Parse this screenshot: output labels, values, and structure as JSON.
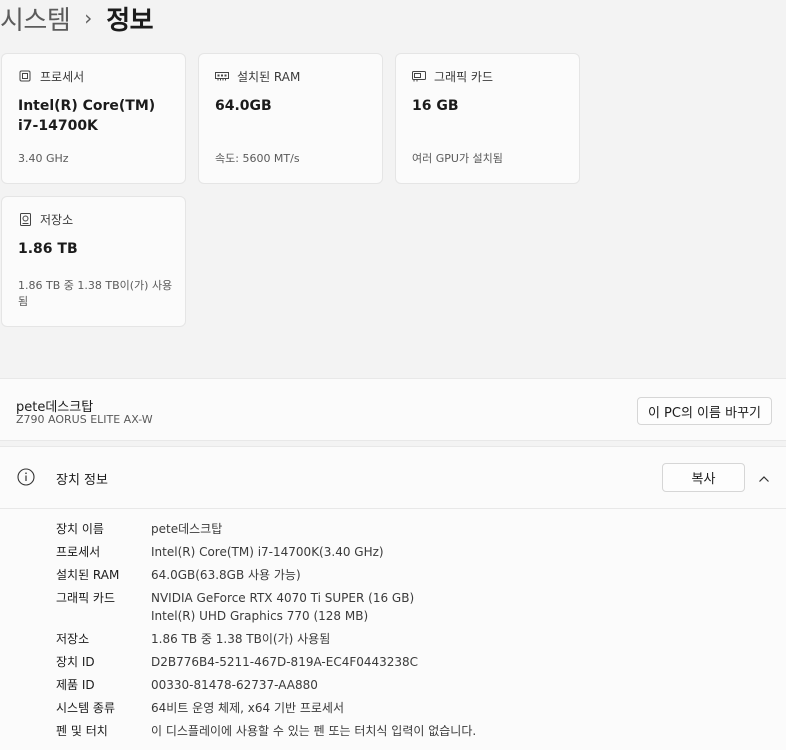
{
  "breadcrumb": {
    "parent": "시스템",
    "separator": "›",
    "current": "정보"
  },
  "cards": [
    {
      "label": "프로세서",
      "value": "Intel(R) Core(TM) i7-14700K",
      "sub": "3.40 GHz",
      "icon": "cpu-icon"
    },
    {
      "label": "설치된 RAM",
      "value": "64.0GB",
      "sub": "속도: 5600 MT/s",
      "icon": "ram-icon"
    },
    {
      "label": "그래픽 카드",
      "value": "16 GB",
      "sub": "여러 GPU가 설치됨",
      "icon": "gpu-icon"
    },
    {
      "label": "저장소",
      "value": "1.86 TB",
      "sub": "1.86 TB 중 1.38 TB이(가) 사용됨",
      "icon": "storage-icon"
    }
  ],
  "device": {
    "name": "pete데스크탑",
    "model": "Z790 AORUS ELITE AX-W",
    "rename_label": "이 PC의 이름 바꾸기"
  },
  "specs": {
    "title": "장치 정보",
    "copy_label": "복사",
    "rows": [
      {
        "key": "장치 이름",
        "value": "pete데스크탑"
      },
      {
        "key": "프로세서",
        "value": "Intel(R) Core(TM) i7-14700K(3.40 GHz)"
      },
      {
        "key": "설치된 RAM",
        "value": "64.0GB(63.8GB 사용 가능)"
      },
      {
        "key": "그래픽 카드",
        "value": "NVIDIA GeForce RTX 4070 Ti SUPER (16 GB)",
        "value2": "Intel(R) UHD Graphics 770 (128 MB)"
      },
      {
        "key": "저장소",
        "value": "1.86 TB 중 1.38 TB이(가) 사용됨"
      },
      {
        "key": "장치 ID",
        "value": "D2B776B4-5211-467D-819A-EC4F0443238C"
      },
      {
        "key": "제품 ID",
        "value": "00330-81478-62737-AA880"
      },
      {
        "key": "시스템 종류",
        "value": "64비트 운영 체제, x64 기반 프로세서"
      },
      {
        "key": "펜 및 터치",
        "value": "이 디스플레이에 사용할 수 있는 펜 또는 터치식 입력이 없습니다."
      }
    ]
  }
}
